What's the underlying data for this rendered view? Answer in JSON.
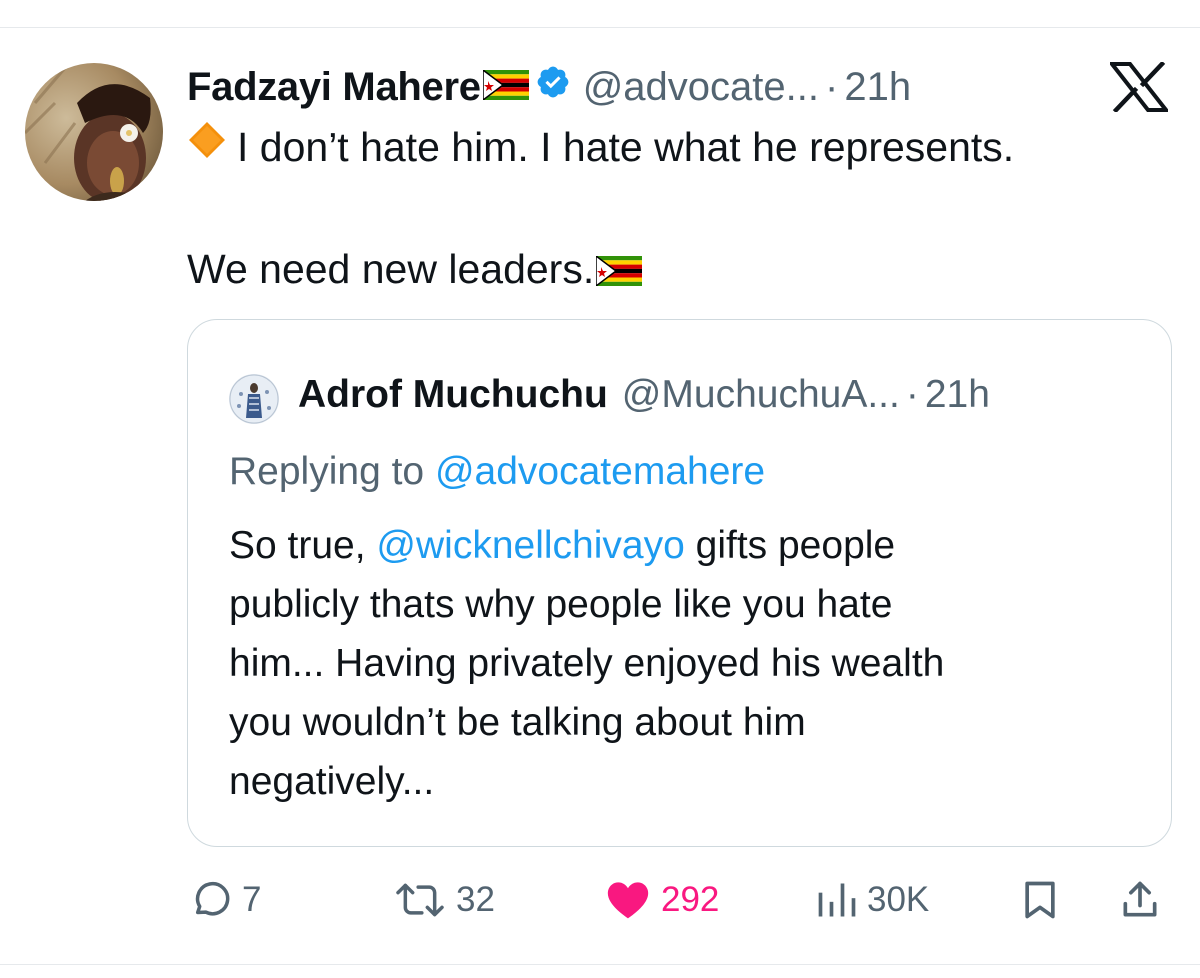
{
  "tweet": {
    "author_name": "Fadzayi Mahere",
    "author_flag": "zimbabwe-flag-emoji",
    "verified": true,
    "handle": "@advocate...",
    "separator": "·",
    "time": "21h",
    "line1": "I don’t hate him. I hate what he represents.",
    "line2": "We need new leaders.",
    "line1_emoji": "orange-diamond-emoji",
    "line2_emoji": "zimbabwe-flag-emoji"
  },
  "quoted": {
    "author_name": "Adrof Muchuchu",
    "handle": "@MuchuchuA...",
    "separator": "·",
    "time": "21h",
    "replying_prefix": "Replying to ",
    "replying_handle": "@advocatemahere",
    "body_line1_prefix": "So true, ",
    "body_mention": "@wicknellchivayo",
    "body_line1_suffix": " gifts people",
    "body_line2": "publicly thats why people like you hate",
    "body_line3": "him... Having privately enjoyed his wealth",
    "body_line4": "you wouldn’t be talking about him",
    "body_line5": "negatively..."
  },
  "actions": {
    "replies": "7",
    "reposts": "32",
    "likes": "292",
    "views": "30K"
  },
  "colors": {
    "text": "#0f1419",
    "secondary": "#536471",
    "link": "#1d9bf0",
    "like": "#f91880",
    "verified": "#1d9bf0",
    "border": "#cfd9de"
  },
  "icons": [
    "x-logo-icon",
    "verified-badge-icon",
    "reply-icon",
    "repost-icon",
    "heart-icon",
    "views-icon",
    "bookmark-icon",
    "share-icon"
  ]
}
